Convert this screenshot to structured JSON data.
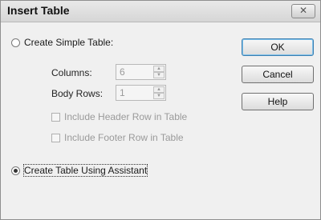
{
  "window": {
    "title": "Insert Table",
    "close_glyph": "✕"
  },
  "options": {
    "simple": {
      "label": "Create Simple Table:",
      "checked": false
    },
    "assistant": {
      "label": "Create Table Using Assistant",
      "checked": true
    }
  },
  "fields": {
    "columns": {
      "label": "Columns:",
      "value": "6"
    },
    "body_rows": {
      "label": "Body Rows:",
      "value": "1"
    }
  },
  "checkboxes": {
    "header_row": {
      "label": "Include Header Row in Table",
      "checked": false
    },
    "footer_row": {
      "label": "Include Footer Row in Table",
      "checked": false
    }
  },
  "buttons": {
    "ok": "OK",
    "cancel": "Cancel",
    "help": "Help"
  },
  "spin_glyphs": {
    "up": "▲",
    "down": "▼"
  }
}
